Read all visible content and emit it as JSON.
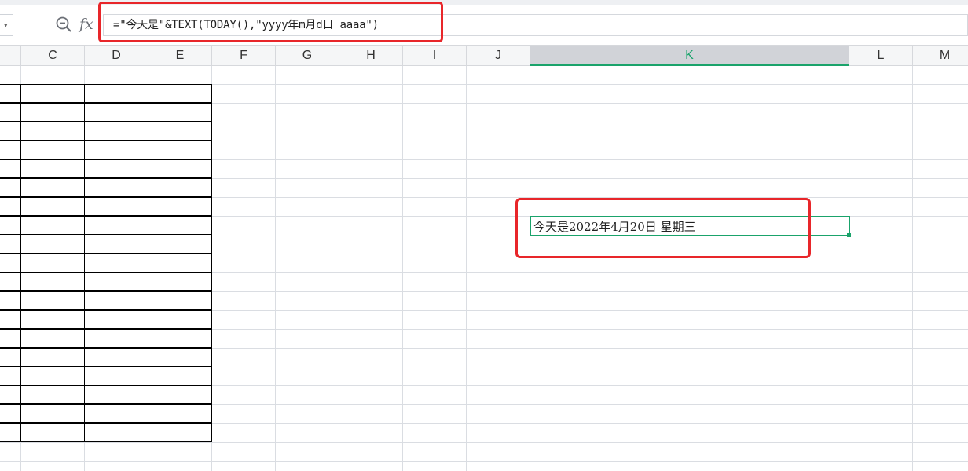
{
  "formula_bar": {
    "name_box_caret": "▾",
    "zoom_icon": "zoom-icon",
    "fx_label": "fx",
    "formula": "=\"今天是\"&TEXT(TODAY(),\"yyyy年m月d日 aaaa\")"
  },
  "columns": [
    "C",
    "D",
    "E",
    "F",
    "G",
    "H",
    "I",
    "J",
    "K",
    "L",
    "M"
  ],
  "active_column": "K",
  "active_cell": {
    "value": "今天是2022年4月20日 星期三"
  },
  "colors": {
    "selection": "#1aa36b",
    "highlight_box": "#e8262a",
    "header_bg": "#f5f6f7",
    "gridline": "#dadde2"
  }
}
